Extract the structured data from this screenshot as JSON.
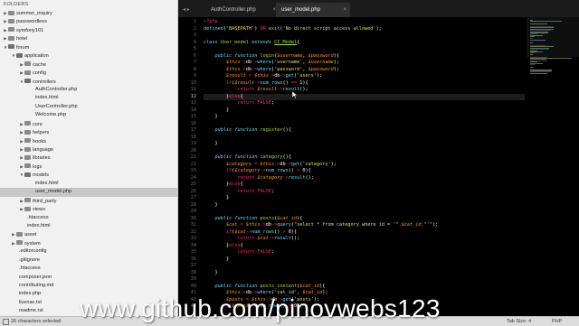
{
  "sidebar": {
    "folders_label": "FOLDERS",
    "tree": [
      {
        "label": "summer_inquiry",
        "depth": 0,
        "folder": true,
        "open": false
      },
      {
        "label": "passwordless",
        "depth": 0,
        "folder": true,
        "open": false
      },
      {
        "label": "symfony101",
        "depth": 0,
        "folder": true,
        "open": false
      },
      {
        "label": "hotel",
        "depth": 0,
        "folder": true,
        "open": false
      },
      {
        "label": "forum",
        "depth": 0,
        "folder": true,
        "open": true
      },
      {
        "label": "application",
        "depth": 1,
        "folder": true,
        "open": true
      },
      {
        "label": "cache",
        "depth": 2,
        "folder": true,
        "open": false
      },
      {
        "label": "config",
        "depth": 2,
        "folder": true,
        "open": false
      },
      {
        "label": "controllers",
        "depth": 2,
        "folder": true,
        "open": true
      },
      {
        "label": "AuthController.php",
        "depth": 3,
        "folder": false
      },
      {
        "label": "index.html",
        "depth": 3,
        "folder": false
      },
      {
        "label": "UserController.php",
        "depth": 3,
        "folder": false
      },
      {
        "label": "Welcome.php",
        "depth": 3,
        "folder": false
      },
      {
        "label": "core",
        "depth": 2,
        "folder": true,
        "open": false
      },
      {
        "label": "helpers",
        "depth": 2,
        "folder": true,
        "open": false
      },
      {
        "label": "hooks",
        "depth": 2,
        "folder": true,
        "open": false
      },
      {
        "label": "language",
        "depth": 2,
        "folder": true,
        "open": false
      },
      {
        "label": "libraries",
        "depth": 2,
        "folder": true,
        "open": false
      },
      {
        "label": "logs",
        "depth": 2,
        "folder": true,
        "open": false
      },
      {
        "label": "models",
        "depth": 2,
        "folder": true,
        "open": true
      },
      {
        "label": "index.html",
        "depth": 3,
        "folder": false
      },
      {
        "label": "user_model.php",
        "depth": 3,
        "folder": false,
        "selected": true
      },
      {
        "label": "third_party",
        "depth": 2,
        "folder": true,
        "open": false
      },
      {
        "label": "views",
        "depth": 2,
        "folder": true,
        "open": false
      },
      {
        "label": ".htaccess",
        "depth": 2,
        "folder": false
      },
      {
        "label": "index.html",
        "depth": 2,
        "folder": false
      },
      {
        "label": "asset",
        "depth": 1,
        "folder": true,
        "open": false
      },
      {
        "label": "system",
        "depth": 1,
        "folder": true,
        "open": false
      },
      {
        "label": ".editorconfig",
        "depth": 1,
        "folder": false
      },
      {
        "label": ".gitignore",
        "depth": 1,
        "folder": false
      },
      {
        "label": ".htaccess",
        "depth": 1,
        "folder": false
      },
      {
        "label": "composer.json",
        "depth": 1,
        "folder": false
      },
      {
        "label": "contributing.md",
        "depth": 1,
        "folder": false
      },
      {
        "label": "index.php",
        "depth": 1,
        "folder": false
      },
      {
        "label": "license.txt",
        "depth": 1,
        "folder": false
      },
      {
        "label": "readme.rst",
        "depth": 1,
        "folder": false
      }
    ]
  },
  "tabs": [
    {
      "label": "AuthController.php",
      "active": false
    },
    {
      "label": "user_model.php",
      "active": true
    }
  ],
  "close_glyph": "×",
  "nav_arrows": "◂ ▸",
  "editor": {
    "current_line": 12,
    "lines": [
      [
        [
          "tg",
          "<?php"
        ]
      ],
      [
        [
          "fn2",
          "defined"
        ],
        [
          "t",
          "("
        ],
        [
          "str",
          "'BASEPATH'"
        ],
        [
          "t",
          ") "
        ],
        [
          "kw2",
          "OR"
        ],
        [
          "t",
          " "
        ],
        [
          "fn2",
          "exit"
        ],
        [
          "t",
          "("
        ],
        [
          "str",
          "'No direct script access allowed'"
        ],
        [
          "t",
          ");"
        ]
      ],
      [],
      [
        [
          "kw",
          "class"
        ],
        [
          "t",
          " "
        ],
        [
          "fn",
          "User_model"
        ],
        [
          "t",
          " "
        ],
        [
          "kw",
          "extends"
        ],
        [
          "t",
          " "
        ],
        [
          "cls",
          "CI_Model"
        ],
        [
          "t",
          "{"
        ]
      ],
      [],
      [
        [
          "t",
          "    "
        ],
        [
          "kw",
          "public"
        ],
        [
          "t",
          " "
        ],
        [
          "kw",
          "function"
        ],
        [
          "t",
          " "
        ],
        [
          "fn",
          "login"
        ],
        [
          "t",
          "("
        ],
        [
          "var",
          "$username"
        ],
        [
          "t",
          ", "
        ],
        [
          "var",
          "$password"
        ],
        [
          "t",
          "){"
        ]
      ],
      [
        [
          "t",
          "        "
        ],
        [
          "var",
          "$this"
        ],
        [
          "kw2",
          "->"
        ],
        [
          "t",
          "db"
        ],
        [
          "kw2",
          "->"
        ],
        [
          "fn2",
          "where"
        ],
        [
          "t",
          "("
        ],
        [
          "str",
          "'username'"
        ],
        [
          "t",
          ", "
        ],
        [
          "var",
          "$username"
        ],
        [
          "t",
          ");"
        ]
      ],
      [
        [
          "t",
          "        "
        ],
        [
          "var",
          "$this"
        ],
        [
          "kw2",
          "->"
        ],
        [
          "t",
          "db"
        ],
        [
          "kw2",
          "->"
        ],
        [
          "fn2",
          "where"
        ],
        [
          "t",
          "("
        ],
        [
          "str",
          "'password'"
        ],
        [
          "t",
          ", "
        ],
        [
          "var",
          "$password"
        ],
        [
          "t",
          ");"
        ]
      ],
      [
        [
          "t",
          "        "
        ],
        [
          "var",
          "$result"
        ],
        [
          "t",
          " "
        ],
        [
          "kw2",
          "="
        ],
        [
          "t",
          " "
        ],
        [
          "var",
          "$this"
        ],
        [
          "kw2",
          "->"
        ],
        [
          "t",
          "db"
        ],
        [
          "kw2",
          "->"
        ],
        [
          "fn2",
          "get"
        ],
        [
          "t",
          "("
        ],
        [
          "str",
          "'users'"
        ],
        [
          "t",
          ");"
        ]
      ],
      [
        [
          "t",
          "        "
        ],
        [
          "kw2",
          "if"
        ],
        [
          "t",
          "("
        ],
        [
          "var",
          "$result"
        ],
        [
          "kw2",
          "->"
        ],
        [
          "fn2",
          "num_rows"
        ],
        [
          "t",
          "() "
        ],
        [
          "kw2",
          "=="
        ],
        [
          "t",
          " 1){"
        ]
      ],
      [
        [
          "t",
          "            "
        ],
        [
          "kw2",
          "return"
        ],
        [
          "t",
          " "
        ],
        [
          "var",
          "$result"
        ],
        [
          "kw2",
          "->"
        ],
        [
          "fn2",
          "result"
        ],
        [
          "t",
          "();"
        ]
      ],
      [
        [
          "t",
          "        }"
        ],
        [
          "kw2",
          "else"
        ],
        [
          "t",
          "{"
        ]
      ],
      [
        [
          "t",
          "            "
        ],
        [
          "kw2",
          "return"
        ],
        [
          "t",
          " "
        ],
        [
          "kw2",
          "FALSE"
        ],
        [
          "t",
          ";"
        ]
      ],
      [
        [
          "t",
          "        }"
        ]
      ],
      [
        [
          "t",
          "    }"
        ]
      ],
      [],
      [
        [
          "t",
          "    "
        ],
        [
          "kw",
          "public"
        ],
        [
          "t",
          " "
        ],
        [
          "kw",
          "function"
        ],
        [
          "t",
          " "
        ],
        [
          "fn",
          "register"
        ],
        [
          "t",
          "(){"
        ]
      ],
      [],
      [
        [
          "t",
          "    }"
        ]
      ],
      [],
      [
        [
          "t",
          "    "
        ],
        [
          "kw",
          "public"
        ],
        [
          "t",
          " "
        ],
        [
          "kw",
          "function"
        ],
        [
          "t",
          " "
        ],
        [
          "fn",
          "category"
        ],
        [
          "t",
          "(){"
        ]
      ],
      [
        [
          "t",
          "        "
        ],
        [
          "var",
          "$category"
        ],
        [
          "t",
          " "
        ],
        [
          "kw2",
          "="
        ],
        [
          "t",
          " "
        ],
        [
          "var",
          "$this"
        ],
        [
          "kw2",
          "->"
        ],
        [
          "t",
          "db"
        ],
        [
          "kw2",
          "->"
        ],
        [
          "fn2",
          "get"
        ],
        [
          "t",
          "("
        ],
        [
          "str",
          "'category'"
        ],
        [
          "t",
          ");"
        ]
      ],
      [
        [
          "t",
          "        "
        ],
        [
          "kw2",
          "if"
        ],
        [
          "t",
          "("
        ],
        [
          "var",
          "$category"
        ],
        [
          "kw2",
          "->"
        ],
        [
          "fn2",
          "num_rows"
        ],
        [
          "t",
          "() "
        ],
        [
          "kw2",
          ">"
        ],
        [
          "t",
          " 0){"
        ]
      ],
      [
        [
          "t",
          "            "
        ],
        [
          "kw2",
          "return"
        ],
        [
          "t",
          " "
        ],
        [
          "var",
          "$category"
        ],
        [
          "kw2",
          "->"
        ],
        [
          "fn2",
          "result"
        ],
        [
          "t",
          "();"
        ]
      ],
      [
        [
          "t",
          "        }"
        ],
        [
          "kw2",
          "else"
        ],
        [
          "t",
          "{"
        ]
      ],
      [
        [
          "t",
          "            "
        ],
        [
          "kw2",
          "return"
        ],
        [
          "t",
          " "
        ],
        [
          "kw2",
          "FALSE"
        ],
        [
          "t",
          ";"
        ]
      ],
      [
        [
          "t",
          "        }"
        ]
      ],
      [
        [
          "t",
          "    }"
        ]
      ],
      [],
      [
        [
          "t",
          "    "
        ],
        [
          "kw",
          "public"
        ],
        [
          "t",
          " "
        ],
        [
          "kw",
          "function"
        ],
        [
          "t",
          " "
        ],
        [
          "fn",
          "posts"
        ],
        [
          "t",
          "("
        ],
        [
          "var",
          "$cat_id"
        ],
        [
          "t",
          "){"
        ]
      ],
      [
        [
          "t",
          "        "
        ],
        [
          "var",
          "$cat"
        ],
        [
          "t",
          " "
        ],
        [
          "kw2",
          "="
        ],
        [
          "t",
          " "
        ],
        [
          "var",
          "$this"
        ],
        [
          "kw2",
          "->"
        ],
        [
          "t",
          "db"
        ],
        [
          "kw2",
          "->"
        ],
        [
          "fn2",
          "query"
        ],
        [
          "t",
          "("
        ],
        [
          "str",
          "\"select * from category where id = '\""
        ],
        [
          "kw2",
          "."
        ],
        [
          "var",
          "$cat_id"
        ],
        [
          "kw2",
          "."
        ],
        [
          "str",
          "\"'\""
        ],
        [
          "t",
          ");"
        ]
      ],
      [
        [
          "t",
          "        "
        ],
        [
          "kw2",
          "if"
        ],
        [
          "t",
          "("
        ],
        [
          "var",
          "$cat"
        ],
        [
          "kw2",
          "->"
        ],
        [
          "fn2",
          "num_rows"
        ],
        [
          "t",
          "() "
        ],
        [
          "kw2",
          ">"
        ],
        [
          "t",
          " 0){"
        ]
      ],
      [
        [
          "t",
          "            "
        ],
        [
          "kw2",
          "return"
        ],
        [
          "t",
          " "
        ],
        [
          "var",
          "$cat"
        ],
        [
          "kw2",
          "->"
        ],
        [
          "fn2",
          "result"
        ],
        [
          "t",
          "();"
        ]
      ],
      [
        [
          "t",
          "        }"
        ],
        [
          "kw2",
          "else"
        ],
        [
          "t",
          "{"
        ]
      ],
      [
        [
          "t",
          "            "
        ],
        [
          "kw2",
          "return"
        ],
        [
          "t",
          " "
        ],
        [
          "kw2",
          "FALSE"
        ],
        [
          "t",
          ";"
        ]
      ],
      [
        [
          "t",
          "        }"
        ]
      ],
      [],
      [
        [
          "t",
          "    }"
        ]
      ],
      [],
      [
        [
          "t",
          "    "
        ],
        [
          "kw",
          "public"
        ],
        [
          "t",
          " "
        ],
        [
          "kw",
          "function"
        ],
        [
          "t",
          " "
        ],
        [
          "fn",
          "posts_content"
        ],
        [
          "t",
          "("
        ],
        [
          "var",
          "$cat_id"
        ],
        [
          "t",
          "){"
        ]
      ],
      [
        [
          "t",
          "        "
        ],
        [
          "var",
          "$this"
        ],
        [
          "kw2",
          "->"
        ],
        [
          "t",
          "db"
        ],
        [
          "kw2",
          "->"
        ],
        [
          "fn2",
          "where"
        ],
        [
          "t",
          "("
        ],
        [
          "str",
          "'cat_id'"
        ],
        [
          "t",
          ", "
        ],
        [
          "var",
          "$cat_id"
        ],
        [
          "t",
          ");"
        ]
      ],
      [
        [
          "t",
          "        "
        ],
        [
          "var",
          "$posts"
        ],
        [
          "t",
          " "
        ],
        [
          "kw2",
          "="
        ],
        [
          "t",
          " "
        ],
        [
          "var",
          "$this"
        ],
        [
          "kw2",
          "->"
        ],
        [
          "t",
          "db"
        ],
        [
          "kw2",
          "->"
        ],
        [
          "fn2",
          "get"
        ],
        [
          "t",
          "("
        ],
        [
          "str",
          "'posts'"
        ],
        [
          "t",
          ");"
        ]
      ],
      [
        [
          "t",
          "        "
        ],
        [
          "kw2",
          "if"
        ],
        [
          "t",
          "("
        ],
        [
          "var",
          "$posts"
        ],
        [
          "kw2",
          "->"
        ],
        [
          "fn2",
          "num_rows"
        ],
        [
          "t",
          "() "
        ],
        [
          "kw2",
          ">"
        ],
        [
          "t",
          " 0){"
        ]
      ]
    ]
  },
  "statusbar": {
    "left": "20 characters selected",
    "tab_size": "Tab Size: 4",
    "language": "PHP"
  },
  "watermark": "www.github.com/pinovwebs123",
  "colors": {
    "editor_bg": "#000000",
    "sidebar_bg": "#f1f1f1",
    "selected_row": "#c7c7c7",
    "keyword": "#66d9ef",
    "operator": "#f92672",
    "variable": "#fd971f",
    "string": "#e6db74",
    "function": "#a6e22e"
  }
}
